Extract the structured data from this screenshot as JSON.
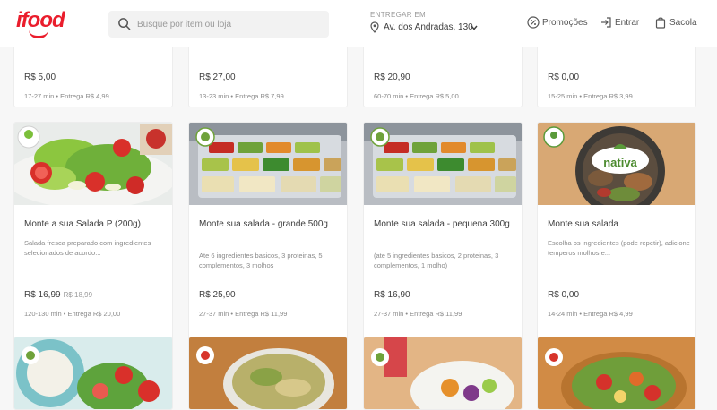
{
  "header": {
    "logo": "ifood",
    "search_placeholder": "Busque por item ou loja",
    "deliver_label": "ENTREGAR EM",
    "deliver_address": "Av. dos Andradas, 130",
    "nav": {
      "promos": "Promoções",
      "login": "Entrar",
      "bag": "Sacola"
    }
  },
  "top_row": [
    {
      "price": "R$ 5,00",
      "meta": "17-27 min • Entrega R$ 4,99"
    },
    {
      "price": "R$ 27,00",
      "meta": "13-23 min • Entrega R$ 7,99"
    },
    {
      "price": "R$ 20,90",
      "meta": "60-70 min • Entrega R$ 5,00"
    },
    {
      "price": "R$ 0,00",
      "meta": "15-25 min • Entrega R$ 3,99"
    }
  ],
  "products": [
    {
      "title": "Monte a sua Salada P (200g)",
      "desc": "Salada fresca preparado com ingredientes selecionados de acordo...",
      "price": "R$ 16,99",
      "old_price": "R$ 18,99",
      "meta": "120-130 min • Entrega R$ 20,00"
    },
    {
      "title": "Monte sua salada - grande 500g",
      "desc": "Ate 6 ingredientes basicos, 3 proteinas, 5 complementos, 3 molhos",
      "price": "R$ 25,90",
      "meta": "27-37 min • Entrega R$ 11,99"
    },
    {
      "title": "Monte sua salada - pequena 300g",
      "desc": "(ate 5 ingredientes basicos, 2 proteinas, 3 complementos, 1 molho)",
      "price": "R$ 16,90",
      "meta": "27-37 min • Entrega R$ 11,99"
    },
    {
      "title": "Monte sua salada",
      "desc": "Escolha os ingredientes (pode repetir), adicione temperos molhos e...",
      "price": "R$ 0,00",
      "meta": "14-24 min • Entrega R$ 4,99"
    }
  ],
  "brand_badges": {
    "nativa": "nativa"
  },
  "colors": {
    "brand": "#ea1d2c",
    "text": "#3e3e3e",
    "muted": "#8a8a8a"
  }
}
